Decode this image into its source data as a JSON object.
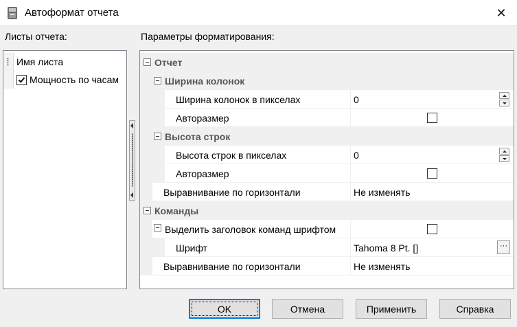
{
  "window": {
    "title": "Автоформат отчета",
    "close_glyph": "✕"
  },
  "left": {
    "label": "Листы отчета:",
    "header": "Имя листа",
    "items": [
      {
        "label": "Мощность по часам",
        "checked": true
      }
    ]
  },
  "right": {
    "label": "Параметры форматирования:",
    "rows": [
      {
        "kind": "cat",
        "level": 0,
        "name": "Отчет"
      },
      {
        "kind": "cat",
        "level": 1,
        "name": "Ширина колонок"
      },
      {
        "kind": "prop",
        "level": 2,
        "name": "Ширина колонок в пикселах",
        "value": "0",
        "editor": "spin"
      },
      {
        "kind": "prop",
        "level": 2,
        "name": "Авторазмер",
        "editor": "check",
        "checked": false
      },
      {
        "kind": "cat",
        "level": 1,
        "name": "Высота строк"
      },
      {
        "kind": "prop",
        "level": 2,
        "name": "Высота строк в пикселах",
        "value": "0",
        "editor": "spin"
      },
      {
        "kind": "prop",
        "level": 2,
        "name": "Авторазмер",
        "editor": "check",
        "checked": false
      },
      {
        "kind": "prop",
        "level": 1,
        "name": "Выравнивание по горизонтали",
        "value": "Не изменять",
        "editor": "text"
      },
      {
        "kind": "cat",
        "level": 0,
        "name": "Команды"
      },
      {
        "kind": "prop",
        "level": 1,
        "name": "Выделить заголовок команд шрифтом",
        "editor": "check",
        "checked": false,
        "expandable": true
      },
      {
        "kind": "prop",
        "level": 2,
        "name": "Шрифт",
        "value": "Tahoma 8 Pt. []",
        "editor": "ellipsis"
      },
      {
        "kind": "prop",
        "level": 1,
        "name": "Выравнивание по горизонтали",
        "value": "Не изменять",
        "editor": "text"
      }
    ],
    "ellipsis_glyph": "···"
  },
  "buttons": {
    "ok": "OK",
    "cancel": "Отмена",
    "apply": "Применить",
    "help": "Справка"
  },
  "colors": {
    "default_button_border": "#0078d7",
    "category_bg": "#f0f0f0",
    "category_text": "#555555"
  }
}
